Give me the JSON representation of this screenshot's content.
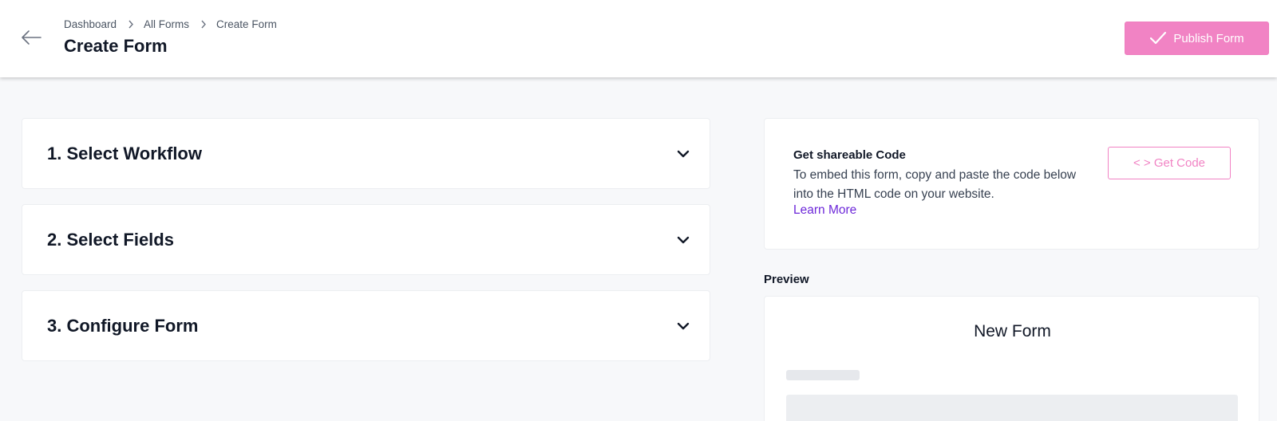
{
  "header": {
    "back_icon": "arrow-left-icon",
    "breadcrumb": [
      "Dashboard",
      "All Forms",
      "Create Form"
    ],
    "title": "Create Form",
    "publish_label": "Publish Form",
    "publish_icon": "check-icon"
  },
  "sections": [
    {
      "label": "1. Select Workflow",
      "icon": "chevron-down-icon"
    },
    {
      "label": "2. Select Fields",
      "icon": "chevron-down-icon"
    },
    {
      "label": "3. Configure Form",
      "icon": "chevron-down-icon"
    }
  ],
  "share": {
    "title": "Get shareable Code",
    "description": "To embed this form, copy and paste the code below into the HTML code on your website.",
    "link": "Learn More",
    "button_label": "< > Get Code"
  },
  "preview": {
    "label": "Preview",
    "form_name": "New Form"
  },
  "colors": {
    "accent_pink": "#f183c4",
    "link_purple": "#6d28d9",
    "background": "#f7f8fa"
  }
}
